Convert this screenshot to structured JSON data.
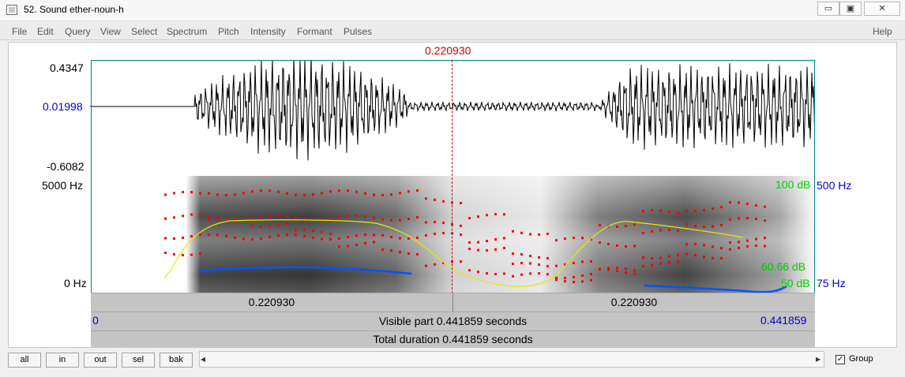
{
  "window": {
    "title": "52. Sound ether-noun-h",
    "minimize_label": "▭",
    "restore_label": "▣",
    "close_label": "✕"
  },
  "menu": {
    "items": [
      "File",
      "Edit",
      "Query",
      "View",
      "Select",
      "Spectrum",
      "Pitch",
      "Intensity",
      "Formant",
      "Pulses"
    ],
    "help": "Help"
  },
  "cursor_time_top": "0.220930",
  "waveform": {
    "max_label": "0.4347",
    "cursor_value_label": "0.01998",
    "min_label": "-0.6082"
  },
  "spectrogram": {
    "top_freq_label": "5000 Hz",
    "bottom_freq_label": "0 Hz",
    "intensity_top_label": "100 dB",
    "pitch_top_label": "500 Hz",
    "intensity_mid_label": "60.66 dB",
    "intensity_bottom_label": "50 dB",
    "pitch_bottom_label": "75 Hz"
  },
  "time_bars": {
    "left_cursor_label": "0.220930",
    "right_cursor_label": "0.220930",
    "visible_start": "0",
    "visible_text": "Visible part 0.441859 seconds",
    "visible_end": "0.441859",
    "total_text": "Total duration 0.441859 seconds"
  },
  "bottom": {
    "buttons": [
      "all",
      "in",
      "out",
      "sel",
      "bak"
    ],
    "scroll_left": "◂",
    "scroll_right": "▸",
    "group_label": "Group",
    "group_checked": "✓"
  },
  "colors": {
    "cursor": "#cc0000",
    "pitch": "#0000cc",
    "intensity": "#00cc00",
    "formant": "#ff0000",
    "pitch_track": "#0055ff",
    "intensity_track": "#e8e800"
  }
}
